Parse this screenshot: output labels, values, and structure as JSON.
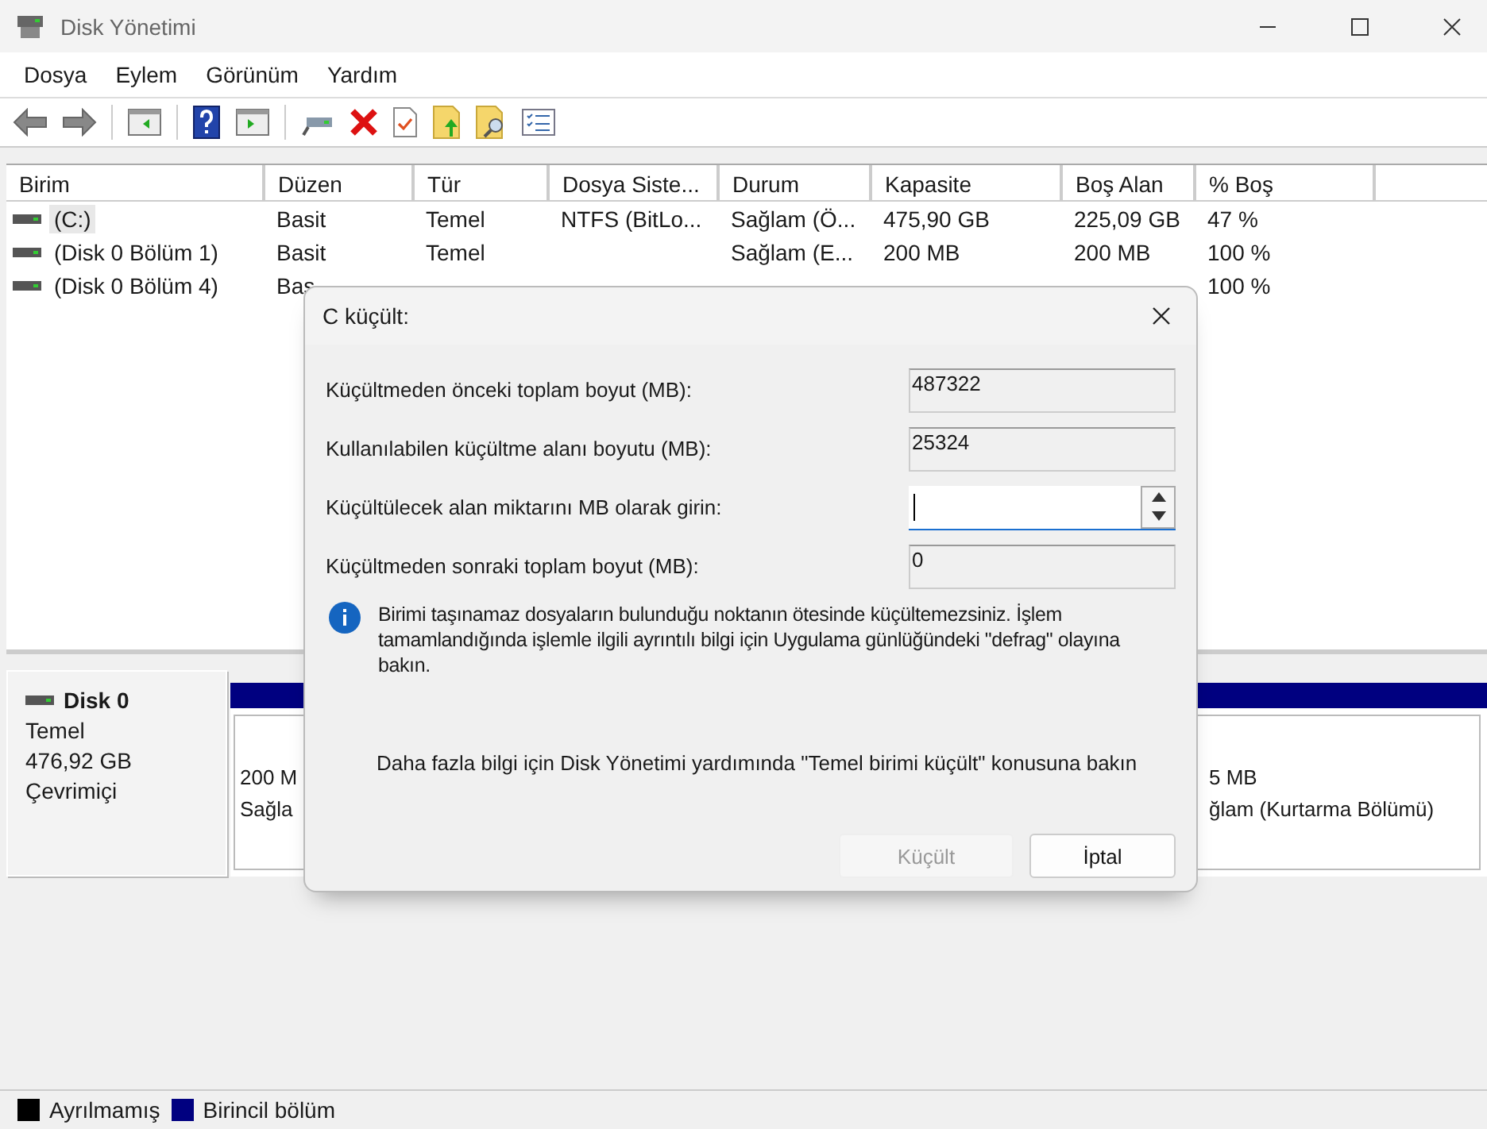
{
  "window": {
    "title": "Disk Yönetimi"
  },
  "menu": [
    {
      "label": "Dosya"
    },
    {
      "label": "Eylem"
    },
    {
      "label": "Görünüm"
    },
    {
      "label": "Yardım"
    }
  ],
  "table": {
    "columns": [
      "Birim",
      "Düzen",
      "Tür",
      "Dosya Siste...",
      "Durum",
      "Kapasite",
      "Boş Alan",
      "% Boş"
    ],
    "rows": [
      {
        "volume": "(C:)",
        "layout": "Basit",
        "type": "Temel",
        "fs": "NTFS (BitLo...",
        "status": "Sağlam (Ö...",
        "capacity": "475,90 GB",
        "free": "225,09 GB",
        "pct_free": "47 %",
        "selected": true
      },
      {
        "volume": "(Disk 0 Bölüm 1)",
        "layout": "Basit",
        "type": "Temel",
        "status": "Sağlam (E...",
        "capacity": "200 MB",
        "free": "200 MB",
        "pct_free": "100 %",
        "selected": false
      },
      {
        "volume": "(Disk 0 Bölüm 4)",
        "layout": "Bas",
        "pct_free": "100 %",
        "selected": false
      }
    ]
  },
  "disk": {
    "name": "Disk 0",
    "type": "Temel",
    "size": "476,92 GB",
    "status": "Çevrimiçi",
    "partitions": [
      {
        "size": "200 M",
        "status": "Sağla"
      },
      {
        "size": "5 MB",
        "status": "ğlam (Kurtarma Bölümü)"
      }
    ]
  },
  "legend": [
    {
      "label": "Ayrılmamış",
      "color": "#000000"
    },
    {
      "label": "Birincil bölüm",
      "color": "#000080"
    }
  ],
  "dialog": {
    "title": "C küçült:",
    "fields": [
      {
        "kind": "readonly",
        "label": "Küçültmeden önceki toplam boyut (MB):",
        "value": "487322"
      },
      {
        "kind": "readonly",
        "label": "Kullanılabilen küçültme alanı boyutu (MB):",
        "value": "25324"
      },
      {
        "kind": "spin",
        "label": "Küçültülecek alan miktarını MB olarak girin:"
      },
      {
        "kind": "readonly",
        "label": "Küçültmeden sonraki toplam boyut (MB):",
        "value": "0"
      }
    ],
    "note": "Birimi taşınamaz dosyaların bulunduğu noktanın ötesinde küçültemezsiniz. İşlem tamamlandığında işlemle ilgili ayrıntılı bilgi için Uygulama günlüğündeki \"defrag\" olayına bakın.",
    "help": "Daha fazla bilgi için Disk Yönetimi yardımında \"Temel birimi küçült\" konusuna bakın",
    "buttons": [
      {
        "label": "Küçült",
        "disabled": true
      },
      {
        "label": "İptal",
        "disabled": false
      }
    ]
  }
}
